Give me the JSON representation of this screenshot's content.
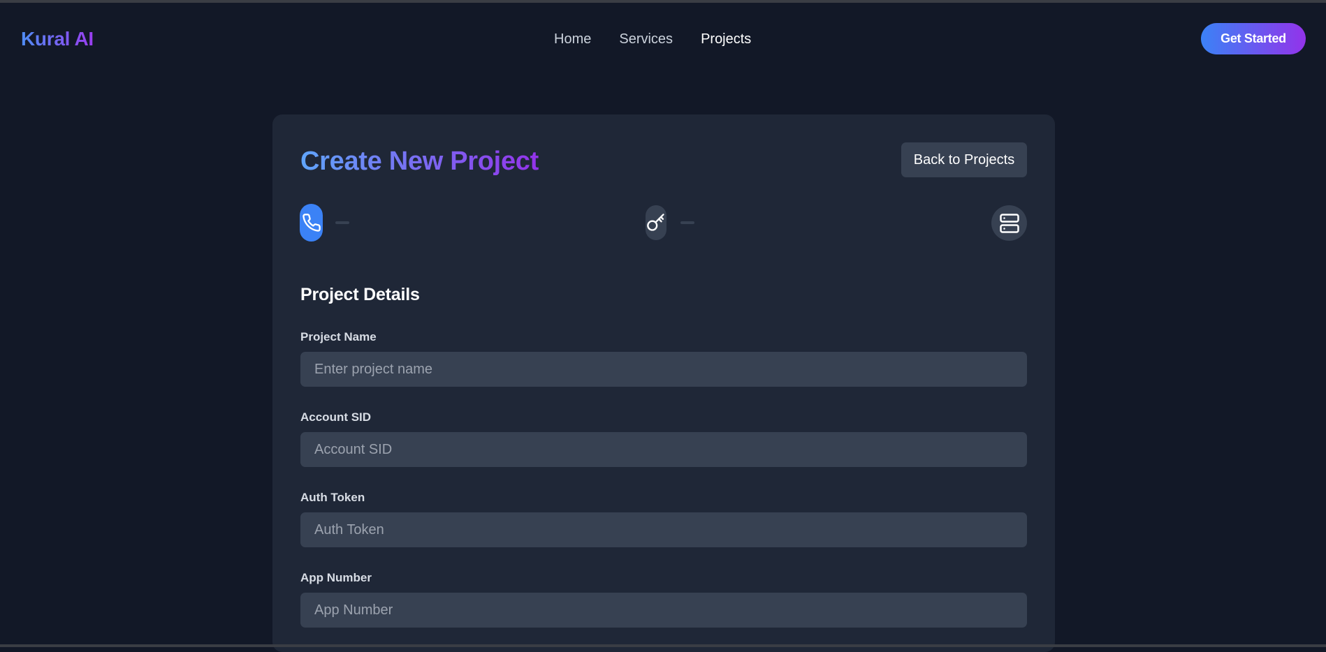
{
  "brand": {
    "name": "Kural AI"
  },
  "nav": {
    "links": [
      {
        "label": "Home"
      },
      {
        "label": "Services"
      },
      {
        "label": "Projects",
        "active": true
      }
    ],
    "cta_label": "Get Started"
  },
  "card": {
    "title": "Create New Project",
    "back_label": "Back to Projects",
    "steps": [
      {
        "icon": "phone-icon",
        "active": true
      },
      {
        "icon": "key-icon",
        "active": false
      },
      {
        "icon": "server-icon",
        "active": false
      }
    ],
    "section_title": "Project Details",
    "fields": [
      {
        "label": "Project Name",
        "placeholder": "Enter project name",
        "value": ""
      },
      {
        "label": "Account SID",
        "placeholder": "Account SID",
        "value": ""
      },
      {
        "label": "Auth Token",
        "placeholder": "Auth Token",
        "value": ""
      },
      {
        "label": "App Number",
        "placeholder": "App Number",
        "value": ""
      }
    ]
  },
  "colors": {
    "background": "#121827",
    "card": "#1f2737",
    "input": "#374152",
    "accent_blue": "#3b82f6",
    "accent_purple": "#9333ea"
  }
}
